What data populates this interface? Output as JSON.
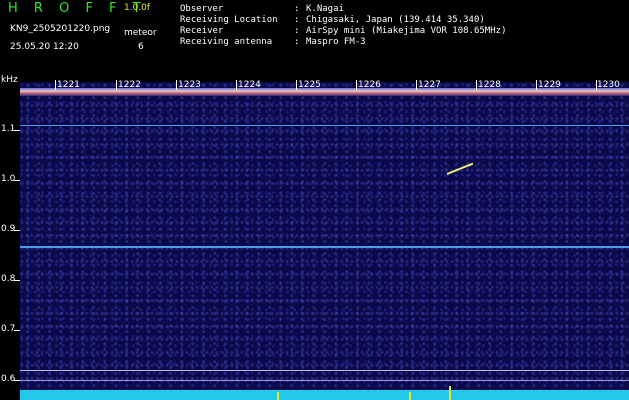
{
  "header": {
    "brand": "H R O F F T",
    "version": "1.0.0f",
    "filename": "KN9_2505201220.png",
    "datetime": "25.05.20 12:20",
    "meteor_label": "meteor",
    "meteor_count": "6",
    "meta": [
      {
        "key": "Observer",
        "value": "K.Nagai"
      },
      {
        "key": "Receiving Location",
        "value": "Chigasaki, Japan (139.414 35.340)"
      },
      {
        "key": "Receiver",
        "value": "AirSpy mini (Miakejima VOR 108.65MHz)"
      },
      {
        "key": "Receiving antenna",
        "value": "Maspro FM-3"
      }
    ]
  },
  "plot": {
    "y_unit": "kHz",
    "y_ticks": [
      "1.1",
      "1.0",
      "0.9",
      "0.8",
      "0.7",
      "0.6"
    ],
    "minute_ticks": [
      "1221",
      "1222",
      "1223",
      "1224",
      "1225",
      "1226",
      "1227",
      "1228",
      "1229",
      "1230"
    ],
    "colors": {
      "background": "#0a0a4a",
      "noise_band": "#d17070",
      "carrier_line": "#4a9ce8",
      "meteor_streak": "#e8ee70",
      "floor": "#22c8e8"
    }
  }
}
